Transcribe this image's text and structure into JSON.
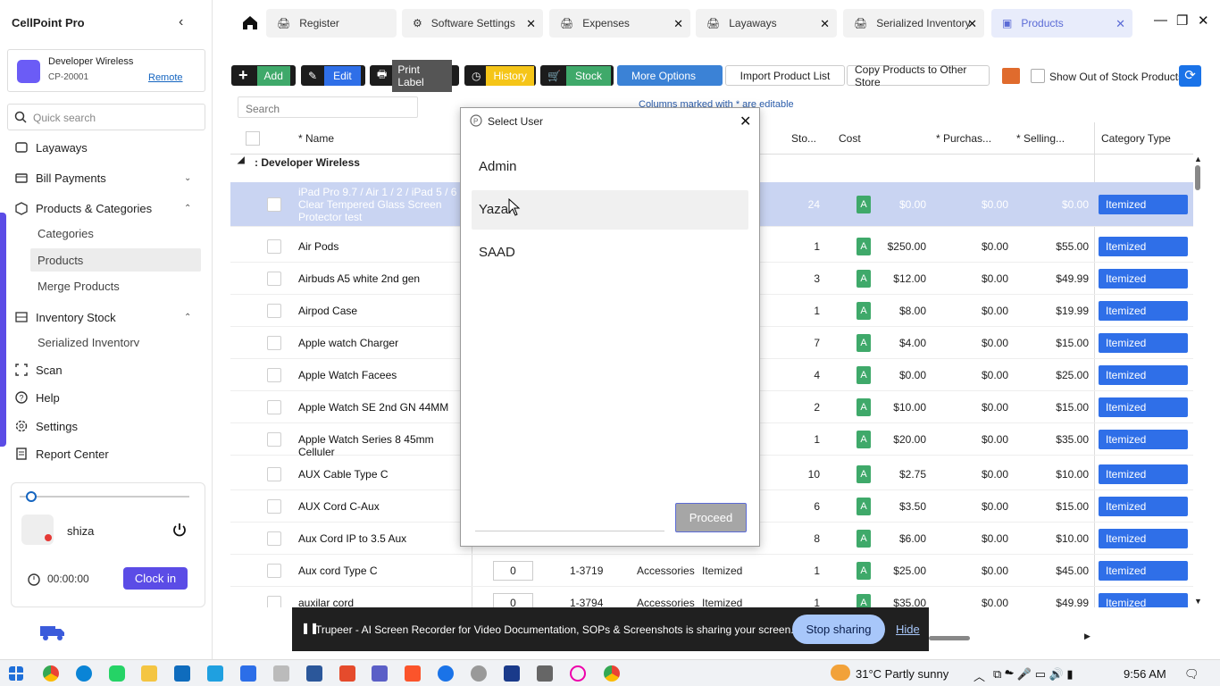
{
  "app": {
    "title": "CellPoint Pro"
  },
  "store": {
    "name": "Developer Wireless",
    "id": "CP-20001",
    "link": "Remote"
  },
  "sidebar": {
    "search_placeholder": "Quick search",
    "items": [
      {
        "label": "Layaways"
      },
      {
        "label": "Bill Payments"
      },
      {
        "label": "Products & Categories"
      },
      {
        "label": "Categories"
      },
      {
        "label": "Products"
      },
      {
        "label": "Merge Products"
      },
      {
        "label": "Inventory Stock"
      },
      {
        "label": "Serialized Inventory"
      },
      {
        "label": "Scan"
      },
      {
        "label": "Help"
      },
      {
        "label": "Settings"
      },
      {
        "label": "Report Center"
      }
    ],
    "user": {
      "name": "shiza",
      "timer": "00:00:00",
      "clockin": "Clock in"
    }
  },
  "tabs": [
    {
      "label": "Register"
    },
    {
      "label": "Software Settings"
    },
    {
      "label": "Expenses"
    },
    {
      "label": "Layaways"
    },
    {
      "label": "Serialized Inventory"
    },
    {
      "label": "Products"
    }
  ],
  "toolbar": {
    "add": "Add",
    "edit": "Edit",
    "print": "Print Label",
    "history": "History",
    "stock": "Stock",
    "more": "More Options",
    "import": "Import Product List",
    "copy": "Copy Products to Other Store",
    "show_oos": "Show Out of Stock Products",
    "search_placeholder": "Search",
    "note": "Columns marked with * are editable"
  },
  "table": {
    "headers": {
      "name": "* Name",
      "stock": "Sto...",
      "cost": "Cost",
      "purchase": "* Purchas...",
      "selling": "* Selling...",
      "category_type": "Category Type"
    },
    "group": ": Developer Wireless",
    "rows": [
      {
        "name": "iPad Pro 9.7 / Air 1 / 2 / iPad 5 / 6 Clear Tempered Glass Screen Protector test",
        "stock": "24",
        "cost": "$0.00",
        "purchase": "$0.00",
        "selling": "$0.00",
        "type": "Itemized",
        "selected": true
      },
      {
        "name": "Air Pods",
        "stock": "1",
        "cost": "$250.00",
        "purchase": "$0.00",
        "selling": "$55.00",
        "type": "Itemized"
      },
      {
        "name": "Airbuds A5 white 2nd gen",
        "stock": "3",
        "cost": "$12.00",
        "purchase": "$0.00",
        "selling": "$49.99",
        "type": "Itemized"
      },
      {
        "name": "Airpod Case",
        "stock": "1",
        "cost": "$8.00",
        "purchase": "$0.00",
        "selling": "$19.99",
        "type": "Itemized"
      },
      {
        "name": "Apple watch Charger",
        "stock": "7",
        "cost": "$4.00",
        "purchase": "$0.00",
        "selling": "$15.00",
        "type": "Itemized"
      },
      {
        "name": "Apple Watch Facees",
        "stock": "4",
        "cost": "$0.00",
        "purchase": "$0.00",
        "selling": "$25.00",
        "type": "Itemized"
      },
      {
        "name": "Apple Watch SE 2nd GN 44MM",
        "stock": "2",
        "cost": "$10.00",
        "purchase": "$0.00",
        "selling": "$15.00",
        "type": "Itemized"
      },
      {
        "name": "Apple Watch Series 8 45mm Celluler",
        "stock": "1",
        "cost": "$20.00",
        "purchase": "$0.00",
        "selling": "$35.00",
        "type": "Itemized"
      },
      {
        "name": "AUX Cable Type C",
        "stock": "10",
        "cost": "$2.75",
        "purchase": "$0.00",
        "selling": "$10.00",
        "type": "Itemized"
      },
      {
        "name": "AUX Cord C-Aux",
        "stock": "6",
        "cost": "$3.50",
        "purchase": "$0.00",
        "selling": "$15.00",
        "type": "Itemized"
      },
      {
        "name": "Aux Cord IP to 3.5 Aux",
        "stock": "8",
        "cost": "$6.00",
        "purchase": "$0.00",
        "selling": "$10.00",
        "type": "Itemized"
      },
      {
        "name": "Aux cord Type C",
        "qty": "0",
        "sku": "1-3719",
        "category": "Accessories",
        "itype": "Itemized",
        "stock": "1",
        "cost": "$25.00",
        "purchase": "$0.00",
        "selling": "$45.00",
        "type": "Itemized"
      },
      {
        "name": "auxilar cord",
        "qty": "0",
        "sku": "1-3794",
        "category": "Accessories",
        "itype": "Itemized",
        "stock": "1",
        "cost": "$35.00",
        "purchase": "$0.00",
        "selling": "$49.99",
        "type": "Itemized"
      }
    ]
  },
  "modal": {
    "title": "Select User",
    "users": [
      "Admin",
      "Yazan",
      "SAAD"
    ],
    "proceed": "Proceed"
  },
  "sharebar": {
    "text": "Trupeer - AI Screen Recorder for Video Documentation, SOPs & Screenshots is sharing your screen.",
    "stop": "Stop sharing",
    "hide": "Hide"
  },
  "taskbar": {
    "weather": "31°C  Partly sunny",
    "time": "9:56 AM"
  },
  "colors": {
    "accent": "#5b4ce6",
    "badge_blue": "#2f6fe8",
    "green": "#3fa96a"
  }
}
